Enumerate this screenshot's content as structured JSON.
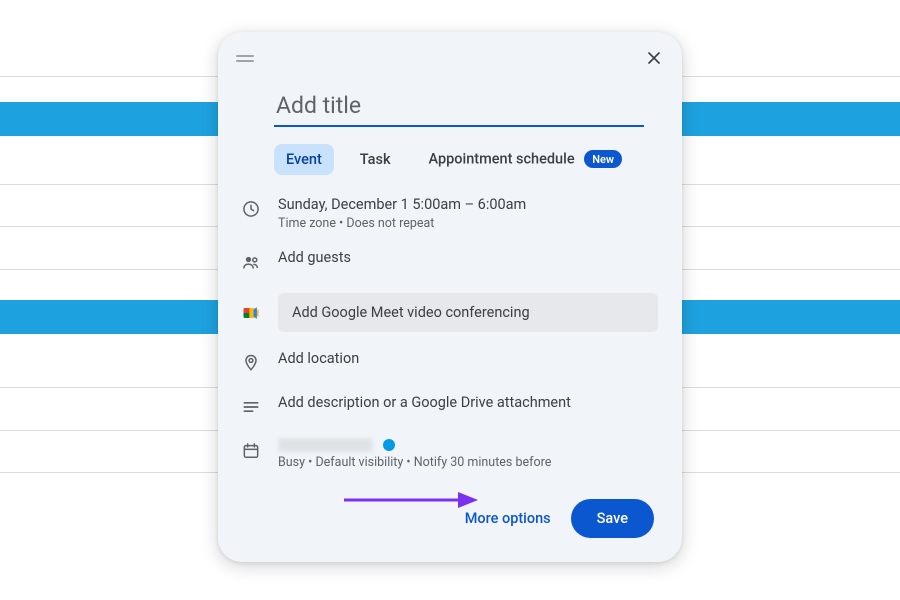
{
  "title": {
    "placeholder": "Add title",
    "value": ""
  },
  "tabs": {
    "event": "Event",
    "task": "Task",
    "appt": "Appointment schedule",
    "appt_badge": "New"
  },
  "datetime": {
    "line": "Sunday, December 1   5:00am  –  6:00am",
    "sub": "Time zone • Does not repeat"
  },
  "guests": {
    "label": "Add guests"
  },
  "meet": {
    "label": "Add Google Meet video conferencing"
  },
  "location": {
    "label": "Add location"
  },
  "description": {
    "label": "Add description or a Google Drive attachment"
  },
  "calendar": {
    "status_line": "Busy • Default visibility • Notify 30 minutes before",
    "dot_color": "#039be5"
  },
  "footer": {
    "more": "More options",
    "save": "Save"
  }
}
